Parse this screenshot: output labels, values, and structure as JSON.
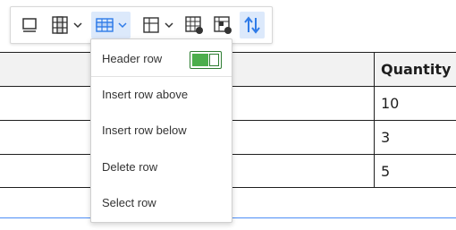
{
  "toolbar": {
    "buttons": [
      {
        "name": "table-caption-icon"
      },
      {
        "name": "column-icon",
        "dropdown": true
      },
      {
        "name": "row-icon",
        "dropdown": true,
        "active": true
      },
      {
        "name": "merge-cells-icon",
        "dropdown": true
      },
      {
        "name": "table-properties-icon"
      },
      {
        "name": "cell-properties-icon"
      },
      {
        "name": "sort-icon"
      }
    ],
    "accent_color": "#2f7be8"
  },
  "row_menu": {
    "header_row_label": "Header row",
    "header_row_enabled": true,
    "items": [
      "Insert row above",
      "Insert row below",
      "Delete row",
      "Select row"
    ]
  },
  "table": {
    "header": "Quantity",
    "quantities": [
      "10",
      "3",
      "5"
    ]
  }
}
